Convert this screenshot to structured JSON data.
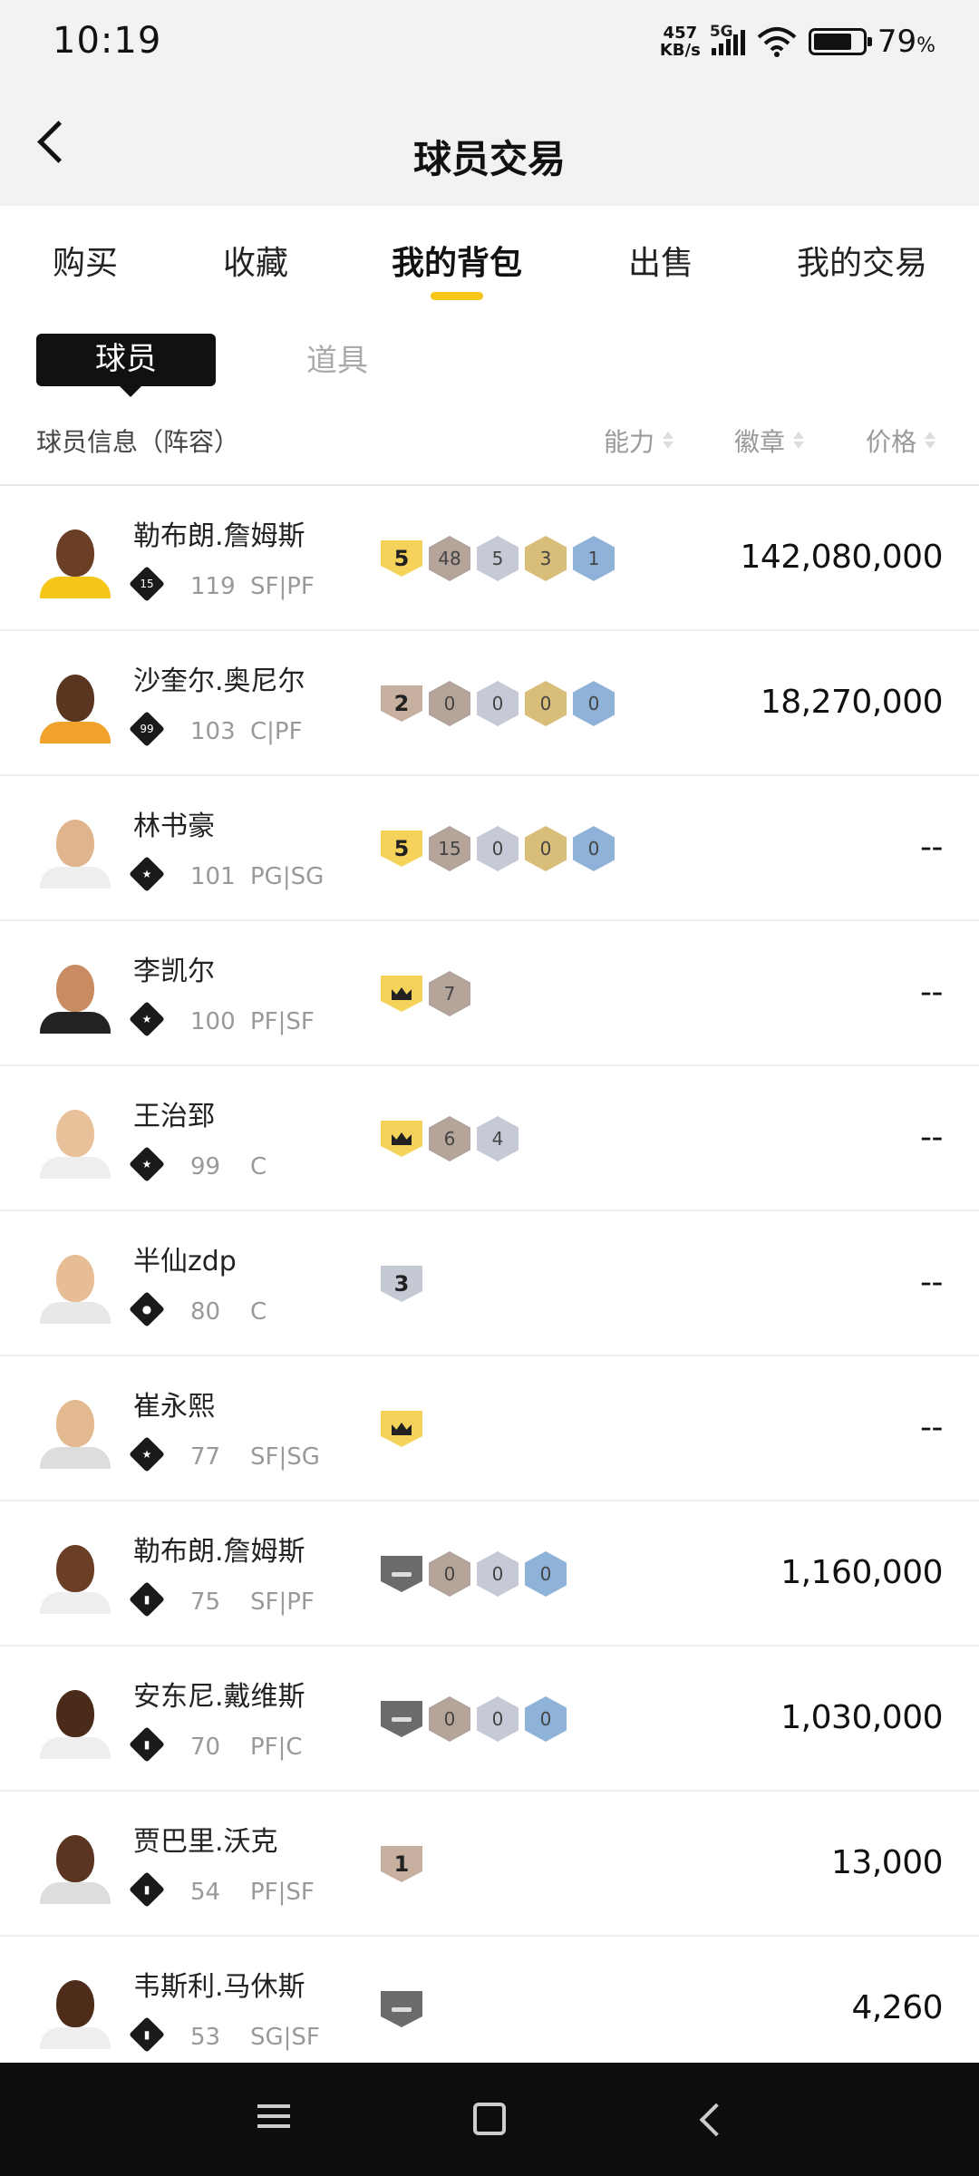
{
  "status_bar": {
    "time": "10:19",
    "net_speed_value": "457",
    "net_speed_unit": "KB/s",
    "network_type": "5G",
    "battery_percent": "79",
    "battery_unit": "%",
    "battery_level": 0.79
  },
  "header": {
    "title": "球员交易",
    "back_icon": "chevron-left-icon"
  },
  "tabs": [
    {
      "label": "购买",
      "active": false
    },
    {
      "label": "收藏",
      "active": false
    },
    {
      "label": "我的背包",
      "active": true
    },
    {
      "label": "出售",
      "active": false
    },
    {
      "label": "我的交易",
      "active": false
    }
  ],
  "sub_tabs": {
    "players": "球员",
    "items": "道具",
    "active": "players"
  },
  "columns": {
    "info": "球员信息（阵容）",
    "ability": "能力",
    "badge": "徽章",
    "price": "价格"
  },
  "colors": {
    "accent": "#f5c518",
    "text": "#222222",
    "muted": "#999999",
    "nav_bar": "#0d0d0d"
  },
  "players": [
    {
      "name": "勒布朗.詹姆斯",
      "rank": "15",
      "rating": "119",
      "position": "SF|PF",
      "level": "5",
      "level_type": "gold",
      "badges": [
        "48",
        "5",
        "3",
        "1"
      ],
      "badge_colors": [
        "bronze",
        "silver",
        "gold",
        "blue"
      ],
      "price": "142,080,000"
    },
    {
      "name": "沙奎尔.奥尼尔",
      "rank": "99",
      "rating": "103",
      "position": "C|PF",
      "level": "2",
      "level_type": "brown",
      "badges": [
        "0",
        "0",
        "0",
        "0"
      ],
      "badge_colors": [
        "bronze",
        "silver",
        "gold",
        "blue"
      ],
      "price": "18,270,000"
    },
    {
      "name": "林书豪",
      "rank": "star",
      "rating": "101",
      "position": "PG|SG",
      "level": "5",
      "level_type": "gold",
      "badges": [
        "15",
        "0",
        "0",
        "0"
      ],
      "badge_colors": [
        "bronze",
        "silver",
        "gold",
        "blue"
      ],
      "price": "--"
    },
    {
      "name": "李凯尔",
      "rank": "star",
      "rating": "100",
      "position": "PF|SF",
      "level": "crown",
      "level_type": "gold",
      "badges": [
        "7"
      ],
      "badge_colors": [
        "bronze"
      ],
      "price": "--"
    },
    {
      "name": "王治郅",
      "rank": "star",
      "rating": "99",
      "position": "C",
      "level": "crown",
      "level_type": "gold",
      "badges": [
        "6",
        "4"
      ],
      "badge_colors": [
        "bronze",
        "silver"
      ],
      "price": "--"
    },
    {
      "name": "半仙zdp",
      "rank": "person",
      "rating": "80",
      "position": "C",
      "level": "3",
      "level_type": "silver",
      "badges": [],
      "badge_colors": [],
      "price": "--"
    },
    {
      "name": "崔永熙",
      "rank": "star",
      "rating": "77",
      "position": "SF|SG",
      "level": "crown",
      "level_type": "gold",
      "badges": [],
      "badge_colors": [],
      "price": "--"
    },
    {
      "name": "勒布朗.詹姆斯",
      "rank": "bars",
      "rating": "75",
      "position": "SF|PF",
      "level": "dash",
      "level_type": "gray",
      "badges": [
        "0",
        "0",
        "0"
      ],
      "badge_colors": [
        "bronze",
        "silver",
        "blue"
      ],
      "price": "1,160,000"
    },
    {
      "name": "安东尼.戴维斯",
      "rank": "bars",
      "rating": "70",
      "position": "PF|C",
      "level": "dash",
      "level_type": "gray",
      "badges": [
        "0",
        "0",
        "0"
      ],
      "badge_colors": [
        "bronze",
        "silver",
        "blue"
      ],
      "price": "1,030,000"
    },
    {
      "name": "贾巴里.沃克",
      "rank": "bars",
      "rating": "54",
      "position": "PF|SF",
      "level": "1",
      "level_type": "brown",
      "badges": [],
      "badge_colors": [],
      "price": "13,000"
    },
    {
      "name": "韦斯利.马休斯",
      "rank": "bars",
      "rating": "53",
      "position": "SG|SF",
      "level": "dash",
      "level_type": "gray",
      "badges": [],
      "badge_colors": [],
      "price": "4,260"
    }
  ],
  "nav_bar": {
    "menu_icon": "menu-icon",
    "home_icon": "home-square-icon",
    "back_icon": "back-triangle-icon"
  }
}
